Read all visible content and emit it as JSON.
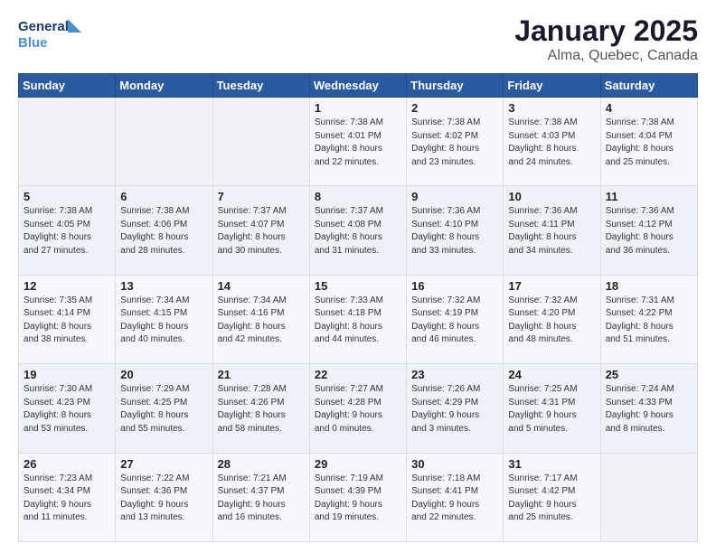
{
  "logo": {
    "line1": "General",
    "line2": "Blue"
  },
  "title": "January 2025",
  "subtitle": "Alma, Quebec, Canada",
  "days_header": [
    "Sunday",
    "Monday",
    "Tuesday",
    "Wednesday",
    "Thursday",
    "Friday",
    "Saturday"
  ],
  "weeks": [
    [
      {
        "day": "",
        "info": ""
      },
      {
        "day": "",
        "info": ""
      },
      {
        "day": "",
        "info": ""
      },
      {
        "day": "1",
        "info": "Sunrise: 7:38 AM\nSunset: 4:01 PM\nDaylight: 8 hours\nand 22 minutes."
      },
      {
        "day": "2",
        "info": "Sunrise: 7:38 AM\nSunset: 4:02 PM\nDaylight: 8 hours\nand 23 minutes."
      },
      {
        "day": "3",
        "info": "Sunrise: 7:38 AM\nSunset: 4:03 PM\nDaylight: 8 hours\nand 24 minutes."
      },
      {
        "day": "4",
        "info": "Sunrise: 7:38 AM\nSunset: 4:04 PM\nDaylight: 8 hours\nand 25 minutes."
      }
    ],
    [
      {
        "day": "5",
        "info": "Sunrise: 7:38 AM\nSunset: 4:05 PM\nDaylight: 8 hours\nand 27 minutes."
      },
      {
        "day": "6",
        "info": "Sunrise: 7:38 AM\nSunset: 4:06 PM\nDaylight: 8 hours\nand 28 minutes."
      },
      {
        "day": "7",
        "info": "Sunrise: 7:37 AM\nSunset: 4:07 PM\nDaylight: 8 hours\nand 30 minutes."
      },
      {
        "day": "8",
        "info": "Sunrise: 7:37 AM\nSunset: 4:08 PM\nDaylight: 8 hours\nand 31 minutes."
      },
      {
        "day": "9",
        "info": "Sunrise: 7:36 AM\nSunset: 4:10 PM\nDaylight: 8 hours\nand 33 minutes."
      },
      {
        "day": "10",
        "info": "Sunrise: 7:36 AM\nSunset: 4:11 PM\nDaylight: 8 hours\nand 34 minutes."
      },
      {
        "day": "11",
        "info": "Sunrise: 7:36 AM\nSunset: 4:12 PM\nDaylight: 8 hours\nand 36 minutes."
      }
    ],
    [
      {
        "day": "12",
        "info": "Sunrise: 7:35 AM\nSunset: 4:14 PM\nDaylight: 8 hours\nand 38 minutes."
      },
      {
        "day": "13",
        "info": "Sunrise: 7:34 AM\nSunset: 4:15 PM\nDaylight: 8 hours\nand 40 minutes."
      },
      {
        "day": "14",
        "info": "Sunrise: 7:34 AM\nSunset: 4:16 PM\nDaylight: 8 hours\nand 42 minutes."
      },
      {
        "day": "15",
        "info": "Sunrise: 7:33 AM\nSunset: 4:18 PM\nDaylight: 8 hours\nand 44 minutes."
      },
      {
        "day": "16",
        "info": "Sunrise: 7:32 AM\nSunset: 4:19 PM\nDaylight: 8 hours\nand 46 minutes."
      },
      {
        "day": "17",
        "info": "Sunrise: 7:32 AM\nSunset: 4:20 PM\nDaylight: 8 hours\nand 48 minutes."
      },
      {
        "day": "18",
        "info": "Sunrise: 7:31 AM\nSunset: 4:22 PM\nDaylight: 8 hours\nand 51 minutes."
      }
    ],
    [
      {
        "day": "19",
        "info": "Sunrise: 7:30 AM\nSunset: 4:23 PM\nDaylight: 8 hours\nand 53 minutes."
      },
      {
        "day": "20",
        "info": "Sunrise: 7:29 AM\nSunset: 4:25 PM\nDaylight: 8 hours\nand 55 minutes."
      },
      {
        "day": "21",
        "info": "Sunrise: 7:28 AM\nSunset: 4:26 PM\nDaylight: 8 hours\nand 58 minutes."
      },
      {
        "day": "22",
        "info": "Sunrise: 7:27 AM\nSunset: 4:28 PM\nDaylight: 9 hours\nand 0 minutes."
      },
      {
        "day": "23",
        "info": "Sunrise: 7:26 AM\nSunset: 4:29 PM\nDaylight: 9 hours\nand 3 minutes."
      },
      {
        "day": "24",
        "info": "Sunrise: 7:25 AM\nSunset: 4:31 PM\nDaylight: 9 hours\nand 5 minutes."
      },
      {
        "day": "25",
        "info": "Sunrise: 7:24 AM\nSunset: 4:33 PM\nDaylight: 9 hours\nand 8 minutes."
      }
    ],
    [
      {
        "day": "26",
        "info": "Sunrise: 7:23 AM\nSunset: 4:34 PM\nDaylight: 9 hours\nand 11 minutes."
      },
      {
        "day": "27",
        "info": "Sunrise: 7:22 AM\nSunset: 4:36 PM\nDaylight: 9 hours\nand 13 minutes."
      },
      {
        "day": "28",
        "info": "Sunrise: 7:21 AM\nSunset: 4:37 PM\nDaylight: 9 hours\nand 16 minutes."
      },
      {
        "day": "29",
        "info": "Sunrise: 7:19 AM\nSunset: 4:39 PM\nDaylight: 9 hours\nand 19 minutes."
      },
      {
        "day": "30",
        "info": "Sunrise: 7:18 AM\nSunset: 4:41 PM\nDaylight: 9 hours\nand 22 minutes."
      },
      {
        "day": "31",
        "info": "Sunrise: 7:17 AM\nSunset: 4:42 PM\nDaylight: 9 hours\nand 25 minutes."
      },
      {
        "day": "",
        "info": ""
      }
    ]
  ]
}
